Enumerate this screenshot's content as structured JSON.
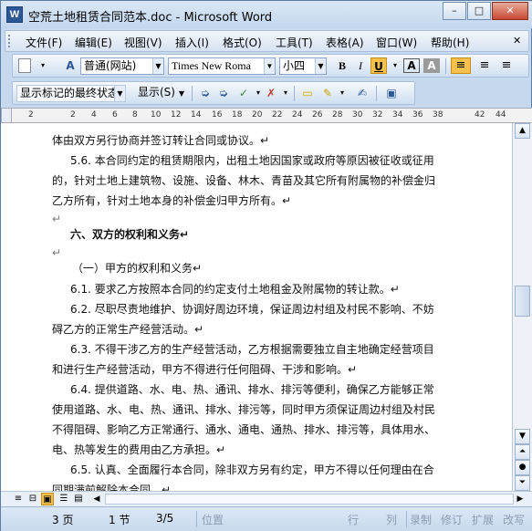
{
  "window": {
    "title": "空荒土地租赁合同范本.doc - Microsoft Word",
    "app_icon_glyph": "W",
    "minimize_glyph": "–",
    "maximize_glyph": "□",
    "close_glyph": "✕"
  },
  "menu": {
    "items": [
      "文件(F)",
      "编辑(E)",
      "视图(V)",
      "插入(I)",
      "格式(O)",
      "工具(T)",
      "表格(A)",
      "窗口(W)",
      "帮助(H)"
    ],
    "close_doc_glyph": "✕"
  },
  "formatting": {
    "style": "普通(网站)",
    "font": "Times New Roma",
    "size": "小四",
    "bold": "B",
    "italic": "I",
    "underline": "U",
    "style_icon_glyph": "A"
  },
  "review": {
    "display_mode": "显示标记的最终状态",
    "show_menu": "显示(S)"
  },
  "ruler": {
    "ticks": [
      "2",
      "2",
      "4",
      "6",
      "8",
      "10",
      "12",
      "14",
      "16",
      "18",
      "20",
      "22",
      "24",
      "26",
      "28",
      "30",
      "32",
      "34",
      "36",
      "38",
      "42",
      "44"
    ]
  },
  "document": {
    "lines": [
      "体由双方另行协商并签订转让合同或协议。↵",
      "5.6. 本合同约定的租赁期限内，出租土地因国家或政府等原因被征收或征用",
      "的，针对土地上建筑物、设施、设备、林木、青苗及其它所有附属物的补偿金归",
      "乙方所有，针对土地本身的补偿金归甲方所有。↵",
      "↵",
      "六、双方的权利和义务↵",
      "↵",
      "（一）甲方的权利和义务↵",
      "6.1. 要求乙方按照本合同的约定支付土地租金及附属物的转让款。↵",
      "6.2. 尽职尽责地维护、协调好周边环境，保证周边村组及村民不影响、不妨",
      "碍乙方的正常生产经营活动。↵",
      "6.3. 不得干涉乙方的生产经营活动，乙方根据需要独立自主地确定经营项目",
      "和进行生产经营活动，甲方不得进行任何阻碍、干涉和影响。↵",
      "6.4. 提供道路、水、电、热、通讯、排水、排污等便利，确保乙方能够正常",
      "使用道路、水、电、热、通讯、排水、排污等，同时甲方须保证周边村组及村民",
      "不得阻碍、影响乙方正常通行、通水、通电、通热、排水、排污等，具体用水、",
      "电、热等发生的费用由乙方承担。↵",
      "6.5. 认真、全面履行本合同，除非双方另有约定，甲方不得以任何理由在合",
      "同期满前解除本合同。↵"
    ]
  },
  "status": {
    "page": "3 页",
    "section": "1 节",
    "page_of": "3/5",
    "position_label": "位置",
    "line_label": "行",
    "column_label": "列",
    "record": "录制",
    "revise": "修订",
    "extend": "扩展",
    "overwrite": "改写"
  },
  "icons": [
    "new-doc-icon",
    "styles-icon",
    "bold-icon",
    "italic-icon",
    "underline-icon",
    "char-border-icon",
    "char-shading-icon",
    "align-left-icon",
    "center-icon",
    "align-right-icon",
    "track-changes-icon",
    "accept-change-icon",
    "reject-change-icon",
    "comment-icon",
    "highlight-icon",
    "reviewing-pane-icon",
    "scroll-up-icon",
    "scroll-down-icon",
    "prev-page-icon",
    "browse-object-icon",
    "next-page-icon",
    "normal-view-icon",
    "web-view-icon",
    "print-view-icon",
    "outline-view-icon",
    "reading-view-icon"
  ],
  "colors": {
    "accent": "#2b5797",
    "toolbar_bg": "#d6e3f3",
    "underline_active": "#f6c24d"
  }
}
